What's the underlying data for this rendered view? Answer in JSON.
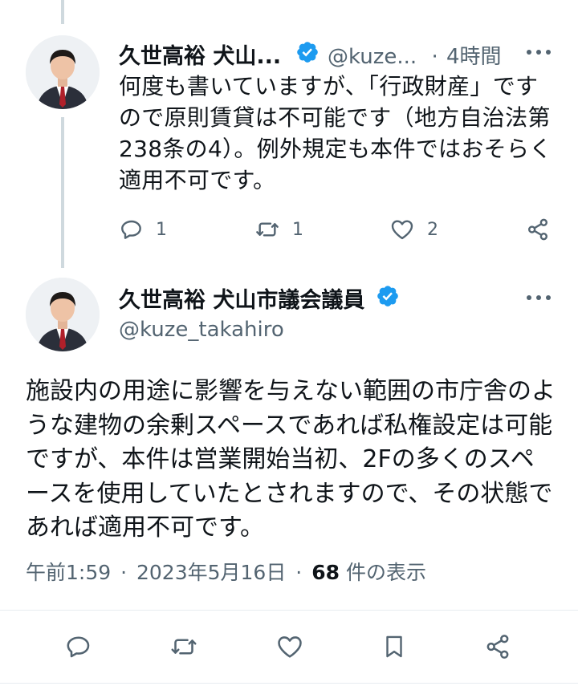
{
  "reply_tweet": {
    "display_name": "久世高裕 犬山...",
    "handle": "@kuze...",
    "separator": "·",
    "time_ago": "4時間",
    "text": "何度も書いていますが、「行政財産」ですので原則賃貸は不可能です（地方自治法第238条の4）。例外規定も本件ではおそらく適用不可です。",
    "reply_count": "1",
    "retweet_count": "1",
    "like_count": "2"
  },
  "main_tweet": {
    "display_name": "久世高裕 犬山市議会議員",
    "handle": "@kuze_takahiro",
    "text": "施設内の用途に影響を与えない範囲の市庁舎のような建物の余剰スペースであれば私権設定は可能ですが、本件は営業開始当初、2Fの多くのスペースを使用していたとされますので、その状態であれば適用不可です。",
    "time": "午前1:59",
    "dot1": "·",
    "date": "2023年5月16日",
    "dot2": "·",
    "views_count": "68",
    "views_label": " 件の表示"
  },
  "colors": {
    "verified_blue": "#1d9bf0",
    "text_primary": "#0f1419",
    "text_secondary": "#536471",
    "thread_line": "#cfd9de"
  },
  "icons": {
    "reply": "reply-icon",
    "retweet": "retweet-icon",
    "like": "like-icon",
    "share": "share-icon",
    "bookmark": "bookmark-icon",
    "more": "more-icon",
    "verified": "verified-badge-icon"
  }
}
